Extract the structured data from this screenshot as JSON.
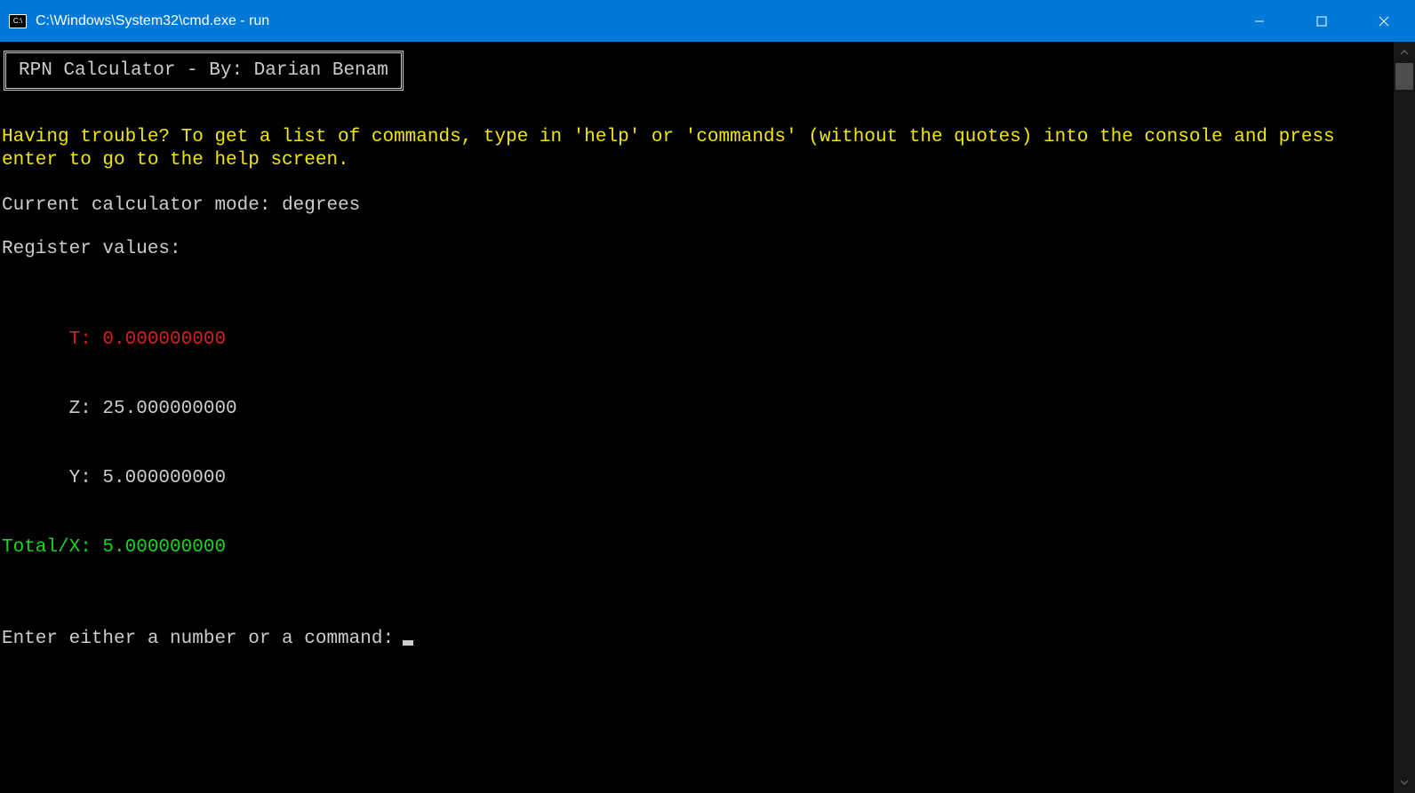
{
  "window": {
    "title": "C:\\Windows\\System32\\cmd.exe - run"
  },
  "app": {
    "box_title": "RPN Calculator - By: Darian Benam",
    "help_text": "Having trouble? To get a list of commands, type in 'help' or 'commands' (without the quotes) into the console and press enter to go to the help screen.",
    "mode_label": "Current calculator mode: ",
    "mode_value": "degrees",
    "registers_header": "Register values:",
    "registers": {
      "t": "      T: 0.000000000",
      "z": "      Z: 25.000000000",
      "y": "      Y: 5.000000000",
      "x": "Total/X: 5.000000000"
    },
    "prompt": "Enter either a number or a command: "
  }
}
